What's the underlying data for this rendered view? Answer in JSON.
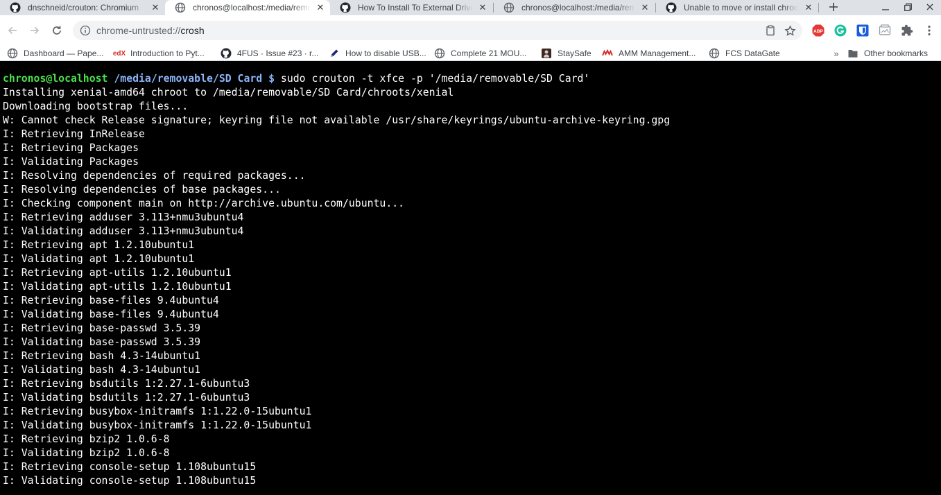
{
  "tabs": [
    {
      "title": "dnschneid/crouton: Chromium",
      "icon": "github-icon",
      "active": false
    },
    {
      "title": "chronos@localhost:/media/removable/SD Card",
      "icon": "globe-icon",
      "active": true
    },
    {
      "title": "How To Install To External Drive",
      "icon": "github-icon",
      "active": false
    },
    {
      "title": "chronos@localhost:/media/removable/SD Card",
      "icon": "globe-icon",
      "active": false
    },
    {
      "title": "Unable to move or install chroot",
      "icon": "github-icon",
      "active": false
    }
  ],
  "omnibox": {
    "scheme": "chrome-untrusted://",
    "host": "crosh"
  },
  "extensions": [
    "abp-icon",
    "grammarly-icon",
    "bitwarden-icon",
    "screenshot-icon",
    "puzzle-icon",
    "menu-icon"
  ],
  "extension_labels": {
    "abp": "ABP"
  },
  "bookmarks": [
    {
      "label": "Dashboard — Pape...",
      "icon": "dashboard-icon"
    },
    {
      "label": "Introduction to Pyt...",
      "icon": "edx-icon",
      "icon_text": "edX"
    },
    {
      "label": "4FUS · Issue #23 · r...",
      "icon": "github-icon"
    },
    {
      "label": "How to disable USB...",
      "icon": "pen-icon"
    },
    {
      "label": "Complete 21 MOU...",
      "icon": "globe-icon"
    },
    {
      "label": "StaySafe",
      "icon": "staysafe-icon"
    },
    {
      "label": "AMM Management...",
      "icon": "amm-icon"
    },
    {
      "label": "FCS DataGate",
      "icon": "globe-icon"
    }
  ],
  "other_bookmarks": "Other bookmarks",
  "terminal": {
    "prompt_user": "chronos@localhost",
    "prompt_path": "/media/removable/SD Card $",
    "command": " sudo crouton -t xfce -p '/media/removable/SD Card'",
    "lines": [
      "Installing xenial-amd64 chroot to /media/removable/SD Card/chroots/xenial",
      "Downloading bootstrap files...",
      "W: Cannot check Release signature; keyring file not available /usr/share/keyrings/ubuntu-archive-keyring.gpg",
      "I: Retrieving InRelease",
      "I: Retrieving Packages",
      "I: Validating Packages",
      "I: Resolving dependencies of required packages...",
      "I: Resolving dependencies of base packages...",
      "I: Checking component main on http://archive.ubuntu.com/ubuntu...",
      "I: Retrieving adduser 3.113+nmu3ubuntu4",
      "I: Validating adduser 3.113+nmu3ubuntu4",
      "I: Retrieving apt 1.2.10ubuntu1",
      "I: Validating apt 1.2.10ubuntu1",
      "I: Retrieving apt-utils 1.2.10ubuntu1",
      "I: Validating apt-utils 1.2.10ubuntu1",
      "I: Retrieving base-files 9.4ubuntu4",
      "I: Validating base-files 9.4ubuntu4",
      "I: Retrieving base-passwd 3.5.39",
      "I: Validating base-passwd 3.5.39",
      "I: Retrieving bash 4.3-14ubuntu1",
      "I: Validating bash 4.3-14ubuntu1",
      "I: Retrieving bsdutils 1:2.27.1-6ubuntu3",
      "I: Validating bsdutils 1:2.27.1-6ubuntu3",
      "I: Retrieving busybox-initramfs 1:1.22.0-15ubuntu1",
      "I: Validating busybox-initramfs 1:1.22.0-15ubuntu1",
      "I: Retrieving bzip2 1.0.6-8",
      "I: Validating bzip2 1.0.6-8",
      "I: Retrieving console-setup 1.108ubuntu15",
      "I: Validating console-setup 1.108ubuntu15"
    ]
  },
  "colors": {
    "prompt_user": "#4ae14a",
    "prompt_path": "#8ab4f8",
    "terminal_bg": "#000000",
    "terminal_fg": "#ffffff",
    "abp_red": "#e53935",
    "grammarly_green": "#15c39a",
    "bitwarden_blue": "#175ddc"
  }
}
